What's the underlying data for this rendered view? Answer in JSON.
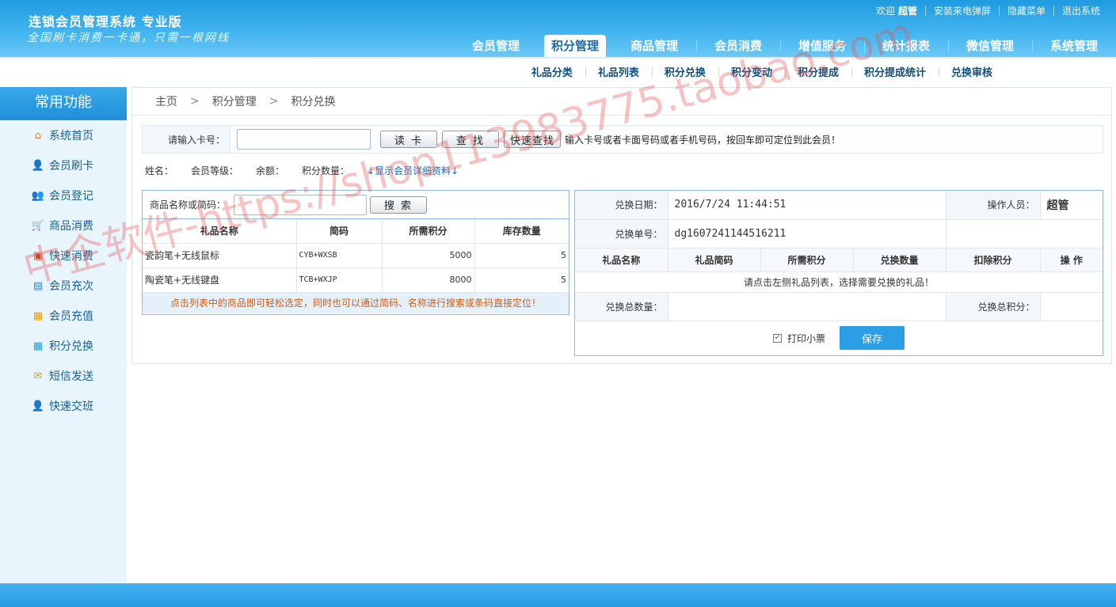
{
  "app": {
    "title": "连锁会员管理系统 专业版",
    "slogan": "全国刷卡消费一卡通，只需一根网线"
  },
  "userbar": {
    "welcome": "欢迎",
    "username": "超管",
    "install_popup": "安装来电弹屏",
    "hide_menu": "隐藏菜单",
    "logout": "退出系统"
  },
  "topnav": [
    {
      "label": "会员管理",
      "active": false
    },
    {
      "label": "积分管理",
      "active": true
    },
    {
      "label": "商品管理",
      "active": false
    },
    {
      "label": "会员消费",
      "active": false
    },
    {
      "label": "增值服务",
      "active": false
    },
    {
      "label": "统计报表",
      "active": false
    },
    {
      "label": "微信管理",
      "active": false
    },
    {
      "label": "系统管理",
      "active": false
    }
  ],
  "subnav": [
    "礼品分类",
    "礼品列表",
    "积分兑换",
    "积分变动",
    "积分提成",
    "积分提成统计",
    "兑换审核"
  ],
  "sidebar": {
    "title": "常用功能",
    "items": [
      {
        "label": "系统首页",
        "icon": "home-icon",
        "glyph": "⌂",
        "color": "#e37b1d"
      },
      {
        "label": "会员刷卡",
        "icon": "card-user-icon",
        "glyph": "👤",
        "color": "#3a7fc0"
      },
      {
        "label": "会员登记",
        "icon": "users-icon",
        "glyph": "👥",
        "color": "#3a7fc0"
      },
      {
        "label": "商品消费",
        "icon": "cart-icon",
        "glyph": "🛒",
        "color": "#d58a1a"
      },
      {
        "label": "快速消费",
        "icon": "chart-icon",
        "glyph": "▣",
        "color": "#d1451f"
      },
      {
        "label": "会员充次",
        "icon": "printer-icon",
        "glyph": "▤",
        "color": "#3a7fc0"
      },
      {
        "label": "会员充值",
        "icon": "coins-icon",
        "glyph": "▦",
        "color": "#e0a010"
      },
      {
        "label": "积分兑换",
        "icon": "grid-icon",
        "glyph": "▦",
        "color": "#2a98d8"
      },
      {
        "label": "短信发送",
        "icon": "mail-icon",
        "glyph": "✉",
        "color": "#d9a020"
      },
      {
        "label": "快速交班",
        "icon": "user-swap-icon",
        "glyph": "👤",
        "color": "#3a7fc0"
      }
    ]
  },
  "breadcrumb": [
    "主页",
    "积分管理",
    "积分兑换"
  ],
  "cardbar": {
    "label": "请输入卡号：",
    "card_value": "",
    "read_button": "读 卡",
    "find_button": "查 找",
    "quick_find_button": "快速查找",
    "hint": "输入卡号或者卡面号码或者手机号码，按回车即可定位到此会员！"
  },
  "member_info": {
    "name_label": "姓名：",
    "level_label": "会员等级：",
    "balance_label": "余额：",
    "points_label": "积分数量：",
    "detail_link": "↓显示会员详细资料↓"
  },
  "gift_panel": {
    "search_label": "商品名称或简码：",
    "search_value": "",
    "search_button": "搜 索",
    "columns": [
      "礼品名称",
      "简码",
      "所需积分",
      "库存数量"
    ],
    "rows": [
      {
        "name": "瓷韵笔+无线鼠标",
        "code": "CYB+WXSB",
        "points": "5000",
        "stock": "5"
      },
      {
        "name": "陶瓷笔+无线键盘",
        "code": "TCB+WXJP",
        "points": "8000",
        "stock": "5"
      }
    ],
    "tip": "点击列表中的商品即可轻松选定，同时也可以通过简码、名称进行搜索或条码直接定位！"
  },
  "exchange_panel": {
    "date_label": "兑换日期：",
    "date_value": "2016/7/24 11:44:51",
    "operator_label": "操作人员：",
    "operator_value": "超管",
    "order_label": "兑换单号：",
    "order_value": "dg1607241144516211",
    "columns": [
      "礼品名称",
      "礼品简码",
      "所需积分",
      "兑换数量",
      "扣除积分",
      "操 作"
    ],
    "empty_hint": "请点击左侧礼品列表，选择需要兑换的礼品！",
    "total_qty_label": "兑换总数量：",
    "total_qty_value": "",
    "total_points_label": "兑换总积分：",
    "total_points_value": "",
    "print_label": "打印小票",
    "print_checked": true,
    "save_button": "保存"
  },
  "watermark": "中企软件-https://shop113983775.taobao.com"
}
